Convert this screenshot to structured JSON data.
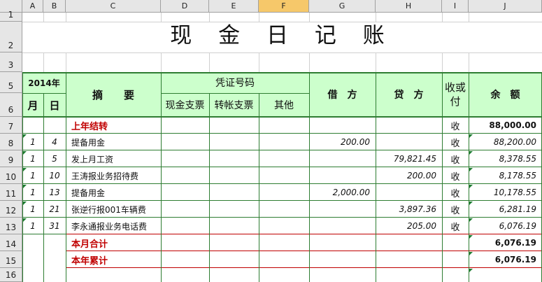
{
  "columns": [
    "A",
    "B",
    "C",
    "D",
    "E",
    "F",
    "G",
    "H",
    "I",
    "J"
  ],
  "rows": [
    "1",
    "2",
    "3",
    "5",
    "6",
    "7",
    "8",
    "9",
    "10",
    "11",
    "12",
    "13",
    "14",
    "15",
    "16"
  ],
  "title": "现 金 日 记 账",
  "header": {
    "year": "2014年",
    "month": "月",
    "day": "日",
    "summary": "摘　　要",
    "voucher_no": "凭证号码",
    "cash_check": "现金支票",
    "transfer_check": "转帐支票",
    "other": "其他",
    "debit": "借　方",
    "credit": "贷　方",
    "direction": "收或付",
    "balance": "余　额"
  },
  "entries": [
    {
      "month": "",
      "day": "",
      "summary": "上年结转",
      "debit": "",
      "credit": "",
      "dir": "收",
      "balance": "88,000.00"
    },
    {
      "month": "1",
      "day": "4",
      "summary": "提备用金",
      "debit": "200.00",
      "credit": "",
      "dir": "收",
      "balance": "88,200.00"
    },
    {
      "month": "1",
      "day": "5",
      "summary": "发上月工资",
      "debit": "",
      "credit": "79,821.45",
      "dir": "收",
      "balance": "8,378.55"
    },
    {
      "month": "1",
      "day": "10",
      "summary": "王涛报业务招待费",
      "debit": "",
      "credit": "200.00",
      "dir": "收",
      "balance": "8,178.55"
    },
    {
      "month": "1",
      "day": "13",
      "summary": "提备用金",
      "debit": "2,000.00",
      "credit": "",
      "dir": "收",
      "balance": "10,178.55"
    },
    {
      "month": "1",
      "day": "21",
      "summary": "张逆行报001车辆费",
      "debit": "",
      "credit": "3,897.36",
      "dir": "收",
      "balance": "6,281.19"
    },
    {
      "month": "1",
      "day": "31",
      "summary": "李永通报业务电话费",
      "debit": "",
      "credit": "205.00",
      "dir": "收",
      "balance": "6,076.19"
    }
  ],
  "totals": [
    {
      "label": "本月合计",
      "balance": "6,076.19"
    },
    {
      "label": "本年累计",
      "balance": "6,076.19"
    }
  ],
  "colors": {
    "header_green": "#1e7d32",
    "header_bg": "#ccffcc",
    "red": "#c00000",
    "selected_col": "#f6c86a"
  }
}
